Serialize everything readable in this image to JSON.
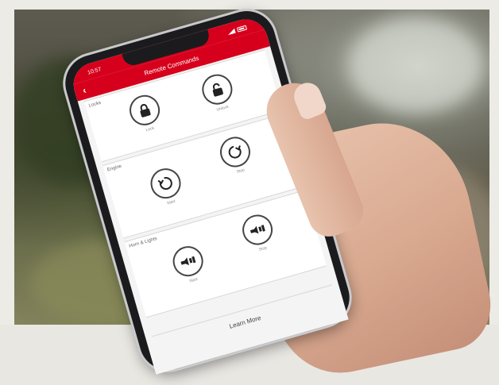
{
  "status_bar": {
    "time": "10:57",
    "signal_icon": "signal-icon",
    "battery_icon": "battery-icon"
  },
  "header": {
    "title": "Remote Commands",
    "back_icon": "back-chevron-icon",
    "accent_color": "#d6001c"
  },
  "sections": [
    {
      "label": "Locks",
      "controls": [
        {
          "icon": "lock-closed-icon",
          "label": "Lock"
        },
        {
          "icon": "lock-open-icon",
          "label": "Unlock"
        }
      ]
    },
    {
      "label": "Engine",
      "controls": [
        {
          "icon": "engine-start-icon",
          "label": "Start"
        },
        {
          "icon": "engine-stop-icon",
          "label": "Stop"
        }
      ]
    },
    {
      "label": "Horn & Lights",
      "controls": [
        {
          "icon": "horn-lights-icon",
          "label": "Start"
        },
        {
          "icon": "horn-lights-icon",
          "label": "Stop"
        }
      ]
    }
  ],
  "footer": {
    "learn_more": "Learn More"
  }
}
